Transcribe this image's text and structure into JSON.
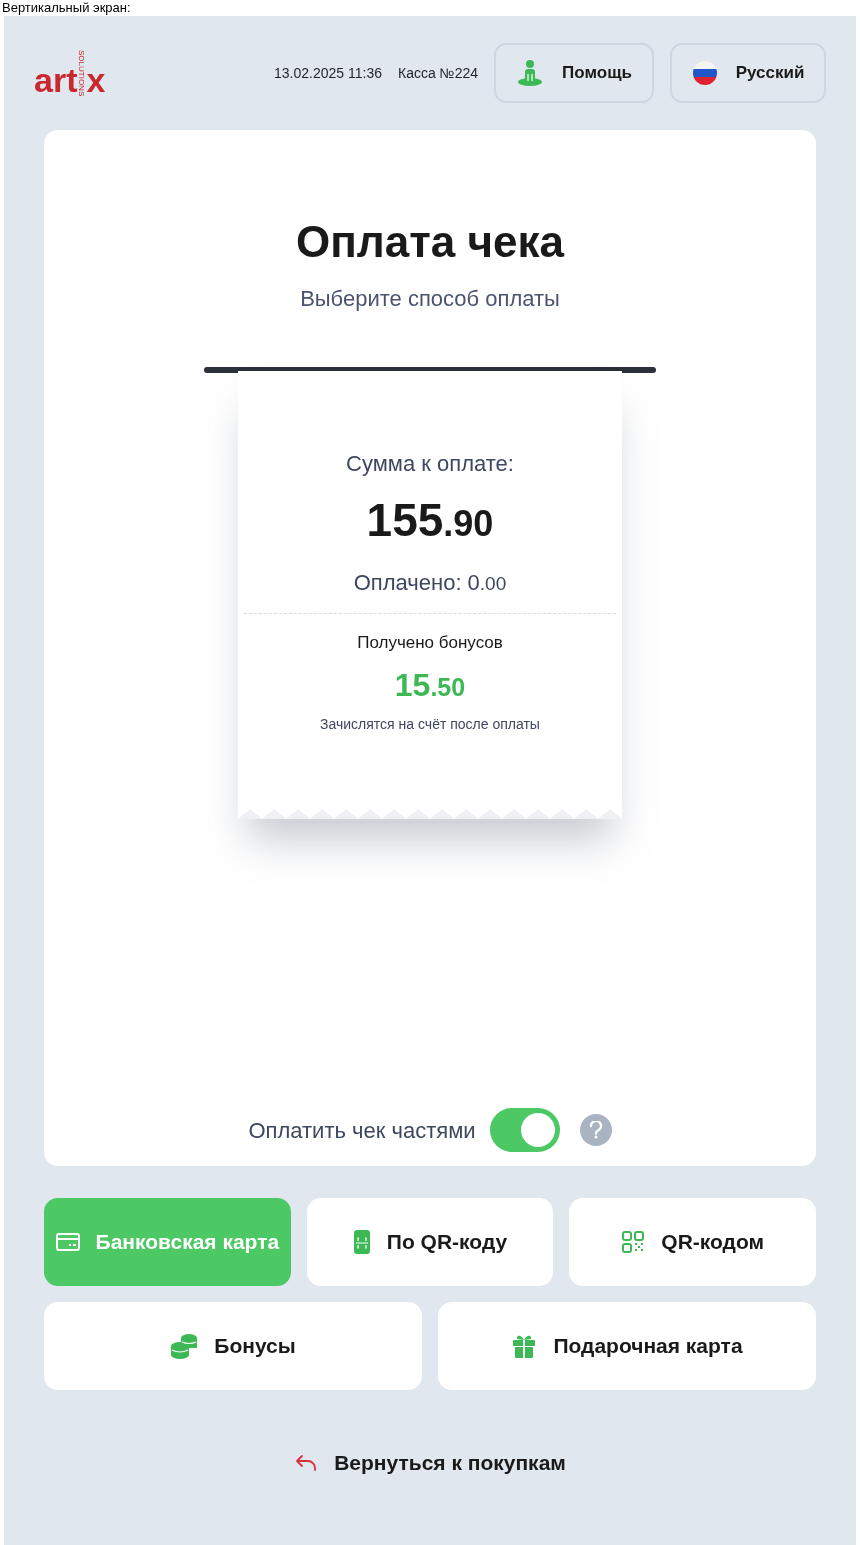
{
  "caption": "Вертикальный экран:",
  "header": {
    "logo": {
      "main": "art",
      "accent": "x",
      "tagline": "SOLUTIONS"
    },
    "datetime": "13.02.2025 11:36",
    "register": "Касса №224",
    "buttons": [
      {
        "kind": "help",
        "label": "Помощь"
      },
      {
        "kind": "language",
        "label": "Русский"
      }
    ]
  },
  "panel": {
    "title": "Оплата чека",
    "subtitle": "Выберите способ оплаты",
    "receipt": {
      "due_label": "Сумма к оплате:",
      "due": {
        "whole": "155",
        "fraction": ".90"
      },
      "paid_label": "Оплачено:",
      "paid": {
        "whole": "0",
        "fraction": ".00"
      },
      "bonus_label": "Получено бонусов",
      "bonus": {
        "whole": "15",
        "fraction": ".50"
      },
      "bonus_note": "Зачислятся на счёт после оплаты"
    },
    "split": {
      "label": "Оплатить чек частями",
      "on": true
    }
  },
  "methods": [
    [
      {
        "kind": "card",
        "label": "Банковская карта",
        "selected": true
      },
      {
        "kind": "phone-qr",
        "label": "По QR-коду",
        "selected": false
      },
      {
        "kind": "qr",
        "label": "QR-кодом",
        "selected": false
      }
    ],
    [
      {
        "kind": "coins",
        "label": "Бонусы",
        "selected": false
      },
      {
        "kind": "gift",
        "label": "Подарочная карта",
        "selected": false
      }
    ]
  ],
  "back": {
    "label": "Вернуться к покупкам"
  }
}
